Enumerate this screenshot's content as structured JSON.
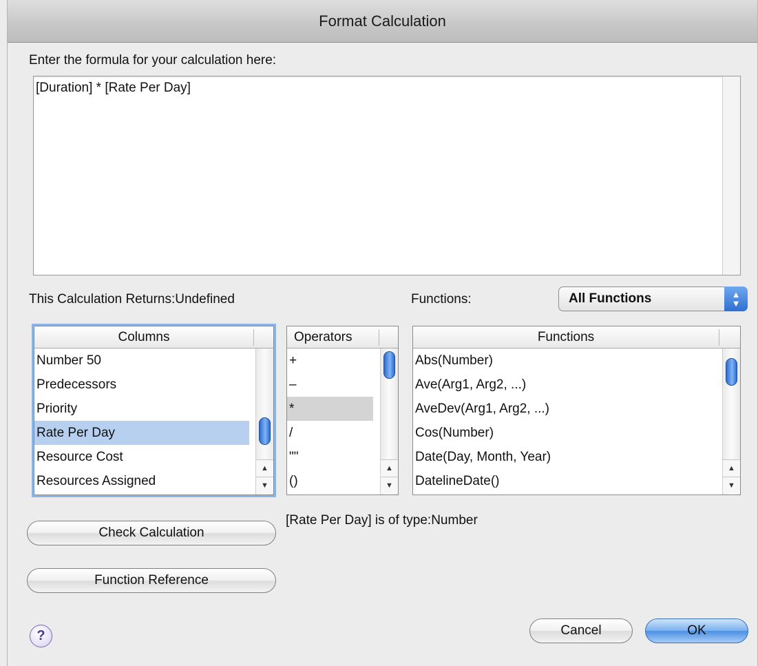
{
  "window": {
    "title": "Format Calculation"
  },
  "formula": {
    "prompt": "Enter the formula for your calculation here:",
    "value": "[Duration] * [Rate Per Day]"
  },
  "returns": {
    "label": "This Calculation Returns:",
    "value": "Undefined"
  },
  "functions_filter": {
    "label": "Functions:",
    "selected": "All Functions"
  },
  "columns": {
    "header": "Columns",
    "items": [
      "Number 50",
      "Predecessors",
      "Priority",
      "Rate Per Day",
      "Resource Cost",
      "Resources Assigned"
    ],
    "selected": "Rate Per Day"
  },
  "operators": {
    "header": "Operators",
    "items": [
      "+",
      "–",
      "*",
      "/",
      "\"\"",
      "()"
    ]
  },
  "functions": {
    "header": "Functions",
    "items": [
      "Abs(Number)",
      "Ave(Arg1, Arg2, ...)",
      "AveDev(Arg1, Arg2, ...)",
      "Cos(Number)",
      "Date(Day, Month, Year)",
      "DatelineDate()"
    ]
  },
  "type_info": "[Rate Per Day] is of type:Number",
  "buttons": {
    "check": "Check Calculation",
    "reference": "Function Reference",
    "cancel": "Cancel",
    "ok": "OK",
    "help": "?"
  },
  "colors": {
    "selection": "#b8d0ef",
    "accent": "#4b8fe2"
  }
}
